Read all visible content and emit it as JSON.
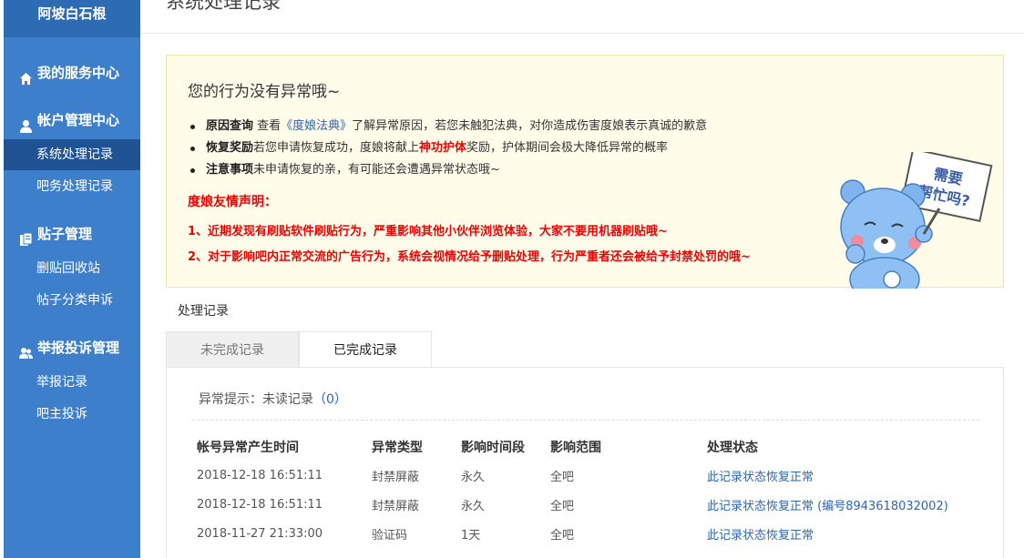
{
  "sidebar": {
    "username": "阿坡白石根",
    "sections": [
      {
        "label": "我的服务中心",
        "icon": "home-icon"
      },
      {
        "label": "帐户管理中心",
        "icon": "user-icon"
      },
      {
        "label": "贴子管理",
        "icon": "document-icon"
      },
      {
        "label": "举报投诉管理",
        "icon": "users-icon"
      }
    ],
    "items": [
      {
        "label": "系统处理记录",
        "active": true
      },
      {
        "label": "吧务处理记录"
      },
      {
        "label": "删贴回收站"
      },
      {
        "label": "帖子分类申诉"
      },
      {
        "label": "举报记录"
      },
      {
        "label": "吧主投诉"
      }
    ]
  },
  "page_title": "系统处理记录",
  "notice": {
    "title": "您的行为没有异常哦~",
    "items": [
      {
        "label": "原因查询",
        "text_before": " 查看",
        "link": "《度娘法典》",
        "text_after": "了解异常原因，若您未触犯法典，对你造成伤害度娘表示真诚的歉意"
      },
      {
        "label": "恢复奖励",
        "text_before": "若您申请恢复成功，度娘将献上",
        "highlight": "神功护体",
        "text_after": "奖励，护体期间会极大降低异常的概率"
      },
      {
        "label": "注意事项",
        "text_after": "未申请恢复的亲，有可能还会遭遇异常状态哦~"
      }
    ],
    "statement_title": "度娘友情声明：",
    "statements": [
      "1、近期发现有刷贴软件刷贴行为，严重影响其他小伙伴浏览体验，大家不要用机器刷贴哦~",
      "2、对于影响吧内正常交流的广告行为，系统会视情况给予删贴处理，行为严重者还会被给予封禁处罚的哦~"
    ],
    "mascot_sign": [
      "需要",
      "帮忙吗?"
    ]
  },
  "records": {
    "title": "处理记录",
    "tabs": {
      "pending": "未完成记录",
      "done": "已完成记录"
    },
    "hint_prefix": "异常提示：未读记录",
    "hint_count": "（0）",
    "columns": [
      "帐号异常产生时间",
      "异常类型",
      "影响时间段",
      "影响范围",
      "处理状态"
    ],
    "rows": [
      [
        "2018-12-18 16:51:11",
        "封禁屏蔽",
        "永久",
        "全吧",
        "此记录状态恢复正常"
      ],
      [
        "2018-12-18 16:51:11",
        "封禁屏蔽",
        "永久",
        "全吧",
        "此记录状态恢复正常 (编号8943618032002)"
      ],
      [
        "2018-11-27 21:33:00",
        "验证码",
        "1天",
        "全吧",
        "此记录状态恢复正常"
      ]
    ]
  },
  "colors": {
    "sidebar": "#3d7fca",
    "sidebar_active": "#1f5394",
    "link": "#2d64b3",
    "alert": "#e00000",
    "notice_bg": "#fffdea"
  }
}
